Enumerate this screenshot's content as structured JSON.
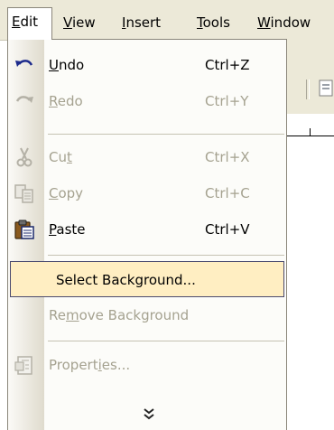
{
  "menubar": {
    "items": [
      {
        "label": "Edit",
        "mnemonic": "E",
        "rest": "dit"
      },
      {
        "label": "View",
        "mnemonic": "V",
        "rest": "iew"
      },
      {
        "label": "Insert",
        "mnemonic": "I",
        "rest": "nsert"
      },
      {
        "label": "Tools",
        "mnemonic": "T",
        "rest": "ools"
      },
      {
        "label": "Window",
        "mnemonic": "W",
        "rest": "indow"
      }
    ]
  },
  "menu": {
    "items": [
      {
        "pre": "",
        "mnemonic": "U",
        "post": "ndo",
        "label": "Undo",
        "shortcut": "Ctrl+Z",
        "enabled": true,
        "icon": "undo-icon"
      },
      {
        "pre": "",
        "mnemonic": "R",
        "post": "edo",
        "label": "Redo",
        "shortcut": "Ctrl+Y",
        "enabled": false,
        "icon": "redo-icon"
      },
      {
        "pre": "Cu",
        "mnemonic": "t",
        "post": "",
        "label": "Cut",
        "shortcut": "Ctrl+X",
        "enabled": false,
        "icon": "cut-icon"
      },
      {
        "pre": "",
        "mnemonic": "C",
        "post": "opy",
        "label": "Copy",
        "shortcut": "Ctrl+C",
        "enabled": false,
        "icon": "copy-icon"
      },
      {
        "pre": "",
        "mnemonic": "P",
        "post": "aste",
        "label": "Paste",
        "shortcut": "Ctrl+V",
        "enabled": true,
        "icon": "paste-icon"
      },
      {
        "label": "Select Background...",
        "enabled": true,
        "highlighted": true
      },
      {
        "pre": "Re",
        "mnemonic": "m",
        "post": "ove Background",
        "label": "Remove Background",
        "enabled": false
      },
      {
        "pre": "Propert",
        "mnemonic": "i",
        "post": "es...",
        "label": "Properties...",
        "enabled": false,
        "icon": "properties-icon"
      }
    ],
    "expand_icon": "chevron-double-down-icon"
  },
  "colors": {
    "highlight_bg": "#ffeec2",
    "highlight_border": "#4b4b6f",
    "disabled_text": "#a5a290",
    "menubar_bg": "#ece9d8"
  }
}
